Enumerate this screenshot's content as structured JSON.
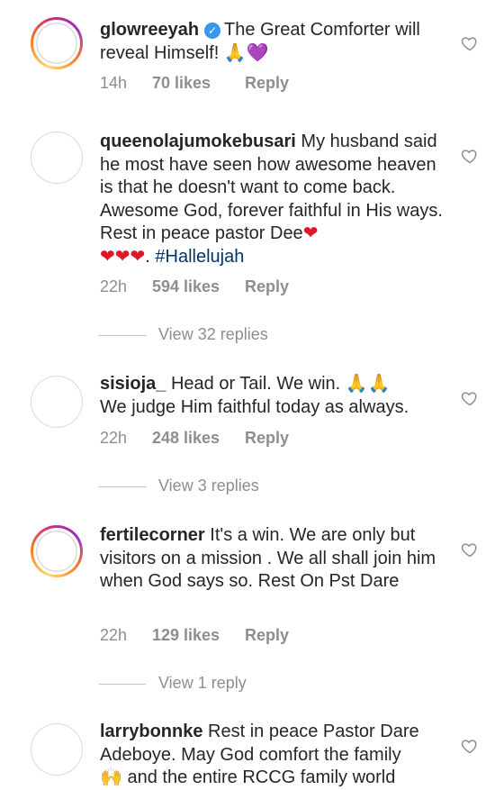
{
  "colors": {
    "text": "#262626",
    "meta": "#8e8e8e",
    "hashtag": "#003569",
    "verified": "#3897f0",
    "heart_red": "#e0162b",
    "story_ring": [
      "#feda75",
      "#fa7e1e",
      "#d62976",
      "#962fbf"
    ]
  },
  "comments": [
    {
      "username": "glowreeyah",
      "verified": true,
      "text": "The Great Comforter will reveal Himself!",
      "emojis": "🙏💜",
      "time": "14h",
      "likes": "70 likes",
      "reply_label": "Reply",
      "avatar": "story-ring"
    },
    {
      "username": "queenolajumokebusari",
      "text": "My husband said he most have seen how awesome heaven is that he doesn't want to come back. Awesome God, forever faithful in His ways. Rest in peace pastor Dee",
      "emojis_after_text": "❤",
      "emojis_line2": "❤❤❤",
      "text_tail": ". ",
      "hashtag": "#Hallelujah",
      "time": "22h",
      "likes": "594 likes",
      "reply_label": "Reply",
      "view_replies": "View 32 replies",
      "avatar": "plain"
    },
    {
      "username": "sisioja_",
      "text": "Head or Tail. We win.",
      "emojis": "🙏🙏",
      "text_2": "We judge Him faithful today as always.",
      "time": "22h",
      "likes": "248 likes",
      "reply_label": "Reply",
      "view_replies": "View 3 replies",
      "avatar": "plain"
    },
    {
      "username": "fertilecorner",
      "text": "It's a win. We are only but visitors on a mission . We all shall join him when God says so. Rest On Pst Dare",
      "time": "22h",
      "likes": "129 likes",
      "reply_label": "Reply",
      "view_replies": "View 1 reply",
      "avatar": "story-ring"
    },
    {
      "username": "larrybonnke",
      "text": "Rest in peace Pastor Dare Adeboye. May God comfort the family",
      "emojis": "🙌",
      "text_2": "and the entire RCCG family world",
      "avatar": "plain"
    }
  ],
  "icons": {
    "like": "heart-outline-icon",
    "verified": "verified-badge-icon"
  }
}
